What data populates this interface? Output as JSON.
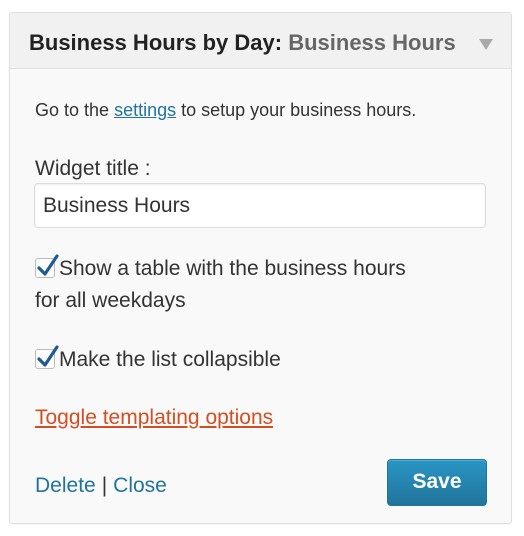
{
  "widget": {
    "title": "Business Hours by Day",
    "title_separator": ":",
    "in_widget_title": "Business Hours",
    "intro_prefix": "Go to the ",
    "intro_link": "settings",
    "intro_suffix": " to setup your business hours.",
    "title_label": "Widget title :",
    "title_value": "Business Hours",
    "options": [
      {
        "label_line1": "Show a table with the business hours",
        "label_line2": "for all weekdays",
        "checked": true
      },
      {
        "label_line1": "Make the list collapsible",
        "checked": true
      }
    ],
    "toggle_templating": "Toggle templating options",
    "delete_label": "Delete",
    "separator": "|",
    "close_label": "Close",
    "save_label": "Save"
  },
  "colors": {
    "link": "#21759b",
    "toggle_link": "#d54e21",
    "save_button": "#21759b",
    "checkmark": "#1e5a96"
  },
  "icons": {
    "header_toggle": "triangle-down-icon",
    "checkbox": "checkmark-icon"
  }
}
